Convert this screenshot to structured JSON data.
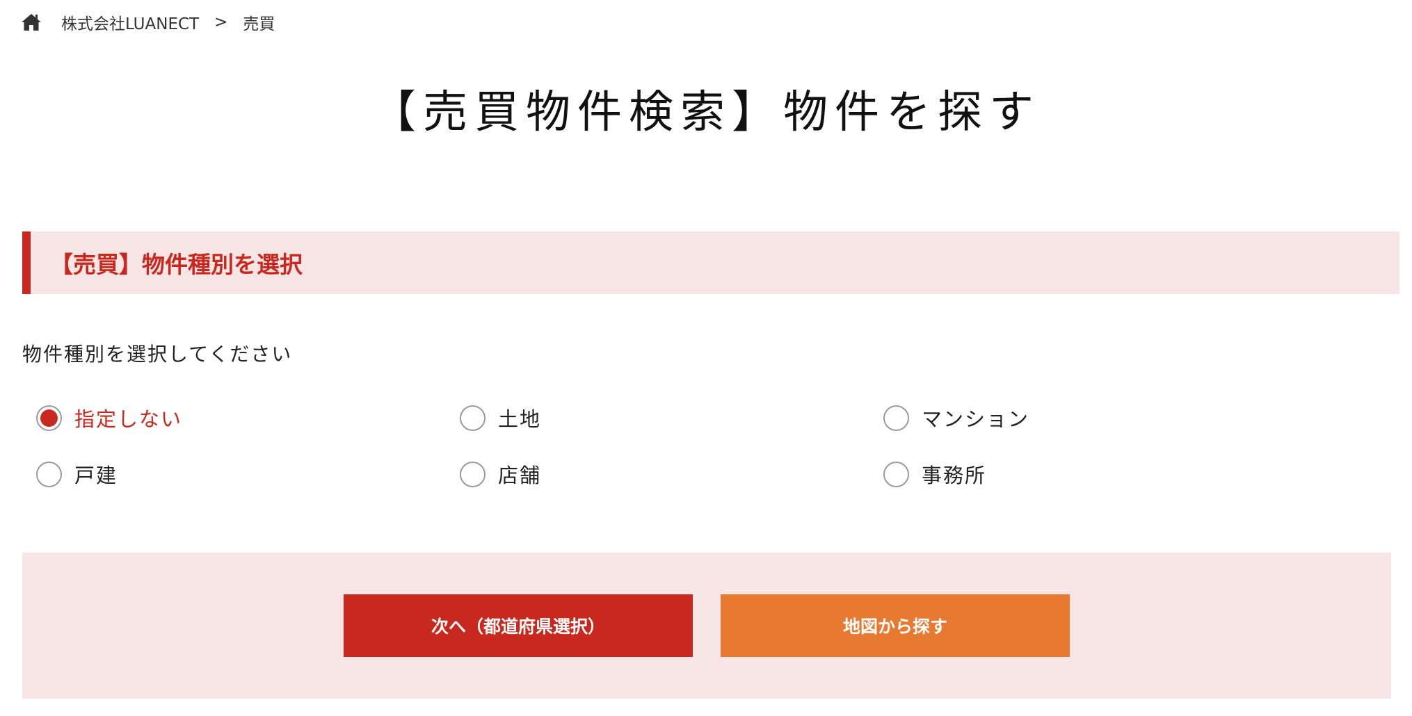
{
  "breadcrumb": {
    "company": "株式会社LUANECT",
    "separator": ">",
    "current": "売買"
  },
  "page_title": "【売買物件検索】物件を探す",
  "section": {
    "title": "【売買】物件種別を選択"
  },
  "instruction": "物件種別を選択してください",
  "property_types": [
    {
      "label": "指定しない",
      "checked": true
    },
    {
      "label": "土地",
      "checked": false
    },
    {
      "label": "マンション",
      "checked": false
    },
    {
      "label": "戸建",
      "checked": false
    },
    {
      "label": "店舗",
      "checked": false
    },
    {
      "label": "事務所",
      "checked": false
    }
  ],
  "actions": {
    "next_label": "次へ（都道府県選択）",
    "map_label": "地図から探す"
  },
  "colors": {
    "accent_red": "#c8281e",
    "accent_orange": "#e77a30",
    "panel_pink": "#f8e6e6"
  }
}
